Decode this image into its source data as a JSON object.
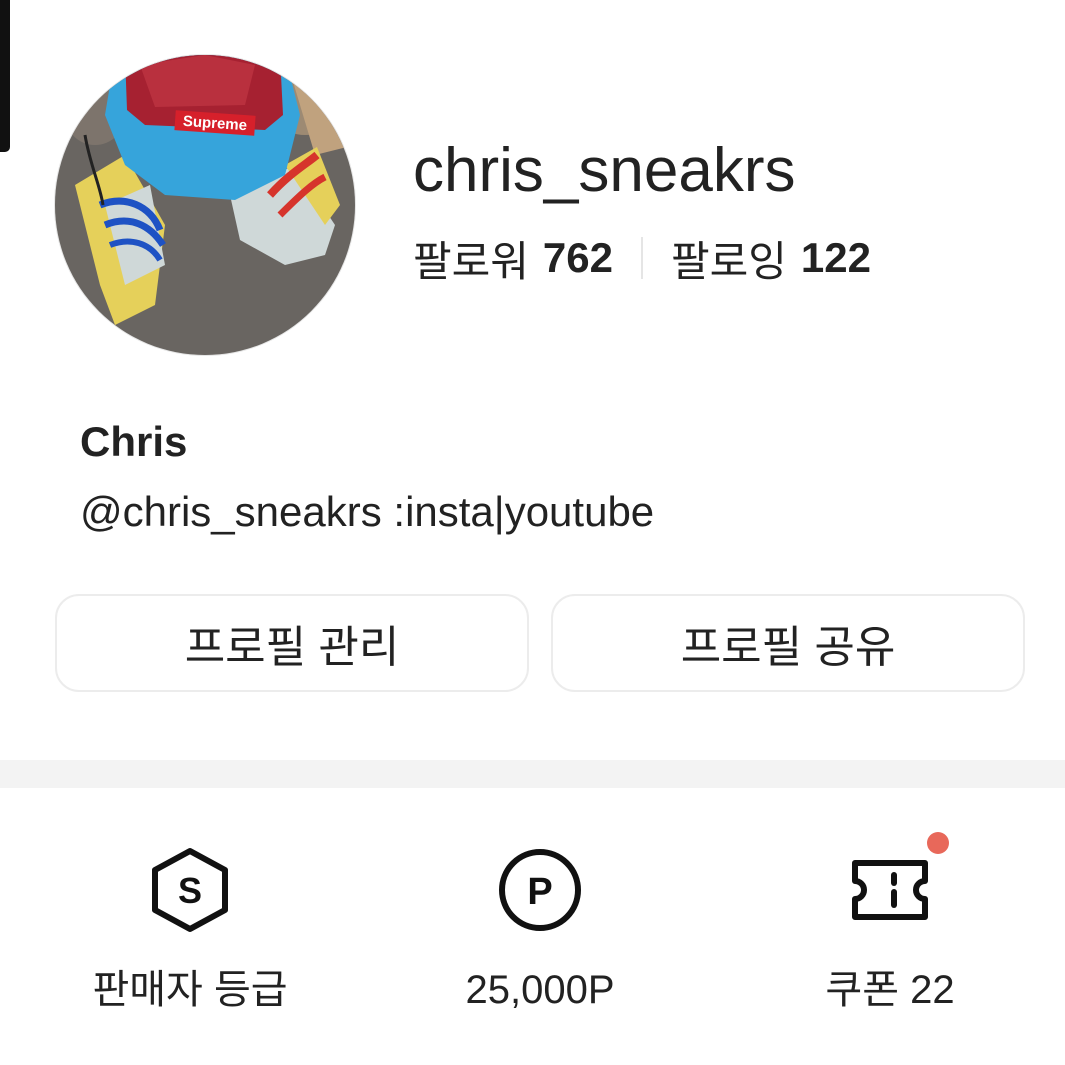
{
  "profile": {
    "username": "chris_sneakrs",
    "avatar_logo_text": "Supreme",
    "followers_label": "팔로워",
    "followers_count": "762",
    "following_label": "팔로잉",
    "following_count": "122",
    "display_name": "Chris",
    "bio": "@chris_sneakrs :insta|youtube"
  },
  "actions": {
    "manage_label": "프로필 관리",
    "share_label": "프로필 공유"
  },
  "metrics": {
    "grade_label": "판매자 등급",
    "grade_icon_letter": "S",
    "points_label": "25,000P",
    "points_icon_letter": "P",
    "coupon_label": "쿠폰 22"
  },
  "icons": {
    "grade": "seller-grade-hexagon-icon",
    "points": "points-circle-icon",
    "coupon": "coupon-ticket-icon"
  },
  "colors": {
    "notification_dot": "#e8685a",
    "text_primary": "#222222",
    "divider": "#f3f3f3"
  }
}
